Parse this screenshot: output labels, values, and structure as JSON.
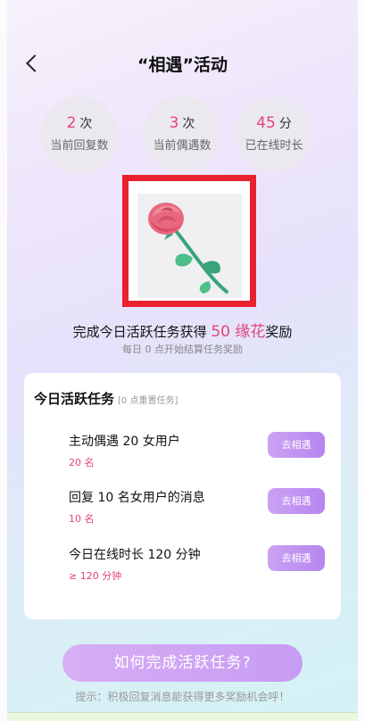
{
  "header": {
    "title": "“相遇”活动"
  },
  "stats": [
    {
      "value": "2",
      "unit": "次",
      "label": "当前回复数"
    },
    {
      "value": "3",
      "unit": "次",
      "label": "当前偶遇数"
    },
    {
      "value": "45",
      "unit": "分",
      "label": "已在线时长"
    }
  ],
  "reward": {
    "prefix": "完成今日活跃任务获得",
    "amount": "50 缘花",
    "suffix": "奖励",
    "sub": "每日 0 点开始结算任务奖励"
  },
  "tasks_card": {
    "title": "今日活跃任务",
    "note": "[0 点重置任务]",
    "items": [
      {
        "name": "主动偶遇 20 女用户",
        "sub": "20 名",
        "button": "去相遇"
      },
      {
        "name": "回复 10 名女用户的消息",
        "sub": "10 名",
        "button": "去相遇"
      },
      {
        "name": "今日在线时长 120 分钟",
        "sub": "≥ 120 分钟",
        "button": "去相遇"
      }
    ]
  },
  "cta": {
    "label": "如何完成活跃任务?"
  },
  "tip": "提示：积极回复消息能获得更多奖励机会呼！",
  "colors": {
    "accent": "#e2457a",
    "button": "#b785ef",
    "highlight_border": "#e9202e"
  },
  "icons": {
    "back": "chevron-left-icon",
    "rose": "rose-icon"
  }
}
